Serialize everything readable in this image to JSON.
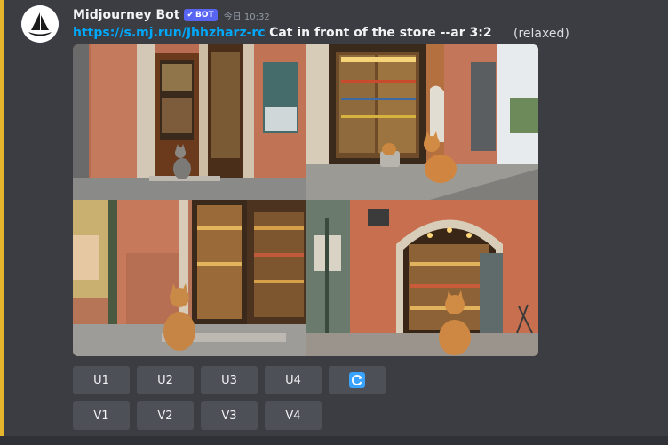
{
  "message": {
    "username": "Midjourney Bot",
    "bot_badge": "BOT",
    "timestamp": "今日 10:32",
    "link": "https://s.mj.run/Jhhzharz-rc",
    "prompt": "Cat in front of the store --ar 3:2",
    "mode": "(relaxed)"
  },
  "image_grid": {
    "tiles": [
      {
        "name": "image-1"
      },
      {
        "name": "image-2"
      },
      {
        "name": "image-3"
      },
      {
        "name": "image-4"
      }
    ]
  },
  "buttons": {
    "upscale": [
      "U1",
      "U2",
      "U3",
      "U4"
    ],
    "variation": [
      "V1",
      "V2",
      "V3",
      "V4"
    ],
    "reroll_icon": "refresh-icon"
  },
  "colors": {
    "accent_bar": "#e6b52e",
    "link": "#00a8fc",
    "bot_badge": "#5865f2",
    "button_bg": "#4e5058",
    "reroll_icon": "#3aa3ff"
  }
}
